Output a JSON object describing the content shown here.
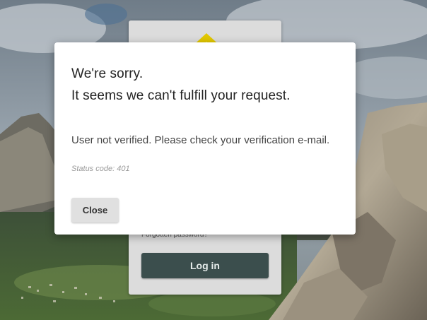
{
  "modal": {
    "title_line1": "We're sorry.",
    "title_line2": "It seems we can't fulfill your request.",
    "message": "User not verified. Please check your verification e-mail.",
    "status": "Status code: 401",
    "close_label": "Close"
  },
  "login": {
    "forgot_label": "Forgotten password?",
    "login_label": "Log in"
  },
  "colors": {
    "login_button": "#3b4e4d",
    "logo_yellow": "#e2c800",
    "close_button": "#e0e0e0"
  },
  "background": {
    "icon": "mountain-landscape"
  }
}
